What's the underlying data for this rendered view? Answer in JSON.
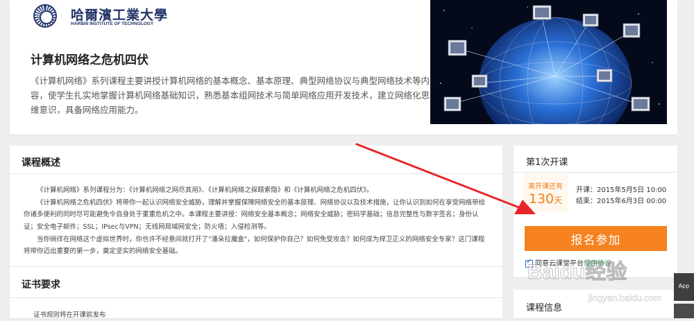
{
  "header": {
    "university_name_cn": "哈爾濱工業大學",
    "university_name_en": "HARBIN INSTITUTE OF TECHNOLOGY"
  },
  "course": {
    "title": "计算机网络之危机四伏",
    "description": "《计算机网络》系列课程主要讲授计算机网络的基本概念、基本原理、典型网络协议与典型网络技术等内容，使学生扎实地掌握计算机网络基础知识，熟悉基本组网技术与简单网络应用开发技术，建立网络化思维意识，具备网络应用能力。"
  },
  "overview": {
    "title": "课程概述",
    "paragraphs": [
      "《计算机网络》系列课程分为：《计算机网络之网尽其用》、《计算机网络之探赜索隐》和《计算机网络之危机四伏》。",
      "《计算机网络之危机四伏》将带你一起认识网络安全威胁，理解并掌握保障网络安全的基本原理、网络协议以及技术措施，让你认识到如何在享受网络带给你诸多便利的同时尽可能避免令自身处于重重危机之中。本课程主要讲授：网络安全基本概念；网络安全威胁；密码学基础；信息完整性与数字签名；身份认证；安全电子邮件；SSL；IPsec与VPN；无线网局域网安全；防火墙；入侵检测等。",
      "当你徜徉在网络这个虚拟世界时，你也许不经意间就打开了\"潘朵拉魔盒\"，如何保护你自己？如何免受攻击？如何成为捍卫正义的网络安全专家？这门课程将带你迈出重要的第一步，奠定坚实的网络安全基础。"
    ]
  },
  "certificate": {
    "title": "证书要求",
    "text": "证书规则将在开课前发布"
  },
  "session": {
    "title": "第1次开课",
    "countdown_label": "离开课还有",
    "countdown_value": "130",
    "countdown_unit": "天",
    "start": "开课：2015年5月5日 10:00",
    "end": "结束：2015年6月3日 00:00",
    "signup_label": "报名参加",
    "agree_prefix": "同意云课堂平台",
    "agree_link": "使用协议"
  },
  "course_info": {
    "title": "课程信息"
  },
  "side_tab": {
    "label": "App"
  },
  "watermark": {
    "brand": "Baidu经验",
    "url": "jingyan.baidu.com"
  },
  "colors": {
    "accent": "#f5811f",
    "countdown": "#f07d1a",
    "annotation_arrow": "#e8262a",
    "brand_navy": "#233366"
  }
}
